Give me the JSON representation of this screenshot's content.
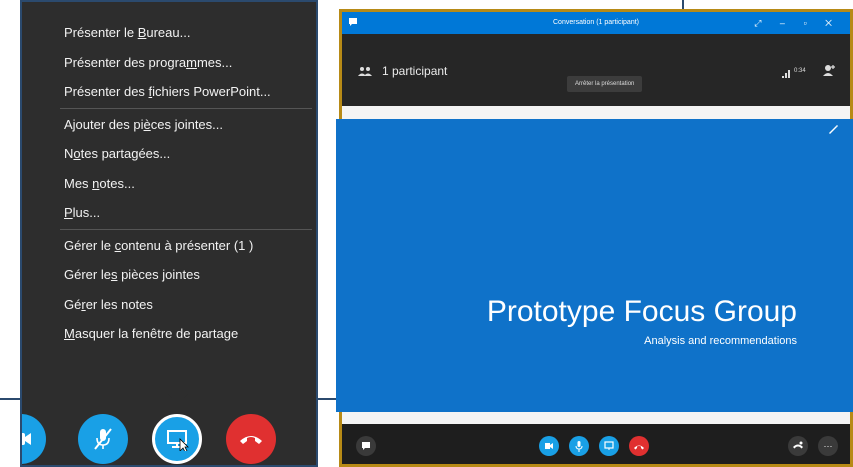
{
  "share_menu": {
    "items": [
      {
        "before": "Présenter le ",
        "key": "B",
        "after": "ureau..."
      },
      {
        "before": "Présenter des progra",
        "key": "m",
        "after": "mes..."
      },
      {
        "before": "Présenter des ",
        "key": "f",
        "after": "ichiers PowerPoint..."
      },
      {
        "before": "Ajouter des pi",
        "key": "è",
        "after": "ces jointes..."
      },
      {
        "before": "N",
        "key": "o",
        "after": "tes partagées..."
      },
      {
        "before": "Mes ",
        "key": "n",
        "after": "otes..."
      },
      {
        "before": "",
        "key": "P",
        "after": "lus..."
      },
      {
        "before": "Gérer le ",
        "key": "c",
        "after": "ontenu à présenter (1 )"
      },
      {
        "before": "Gérer le",
        "key": "s",
        "after": " pièces jointes"
      },
      {
        "before": "Gé",
        "key": "r",
        "after": "er les notes"
      },
      {
        "before": "",
        "key": "M",
        "after": "asquer la fenêtre de partage"
      }
    ]
  },
  "conversation": {
    "title": "Conversation (1 participant)",
    "participants_label": "1 participant",
    "duration": "0:34",
    "tooltip": "Arrêter la présentation"
  },
  "slide": {
    "title": "Prototype Focus Group",
    "subtitle": "Analysis and recommendations"
  },
  "colors": {
    "accent_blue": "#19a0e6",
    "hangup_red": "#e03030",
    "slide_blue": "#0f72c9",
    "titlebar_blue": "#0078d7",
    "window_border": "#b78a16"
  },
  "icons": {
    "menu_buttons": [
      "video-camera-icon",
      "microphone-muted-icon",
      "present-screen-icon",
      "hang-up-icon"
    ],
    "conversation_buttons": [
      "chat-icon",
      "video-camera-icon",
      "microphone-icon",
      "present-screen-icon",
      "hang-up-icon",
      "call-controls-icon",
      "more-options-icon"
    ]
  }
}
